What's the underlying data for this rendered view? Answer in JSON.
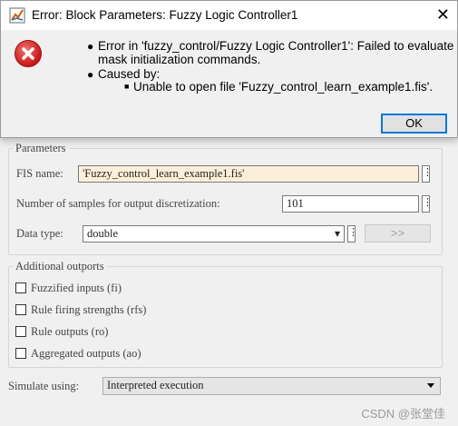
{
  "error_dialog": {
    "title": "Error: Block Parameters: Fuzzy Logic  Controller1",
    "close_glyph": "✕",
    "icon": "error-icon",
    "messages": [
      "Error in 'fuzzy_control/Fuzzy Logic Controller1': Failed to evaluate",
      "mask initialization commands.",
      "Caused by:",
      "Unable to open file 'Fuzzy_control_learn_example1.fis'."
    ],
    "ok_label": "OK"
  },
  "parameters": {
    "legend": "Parameters",
    "fis_name_label": "FIS name:",
    "fis_name_value": "'Fuzzy_control_learn_example1.fis'",
    "samples_label": "Number of samples for output discretization:",
    "samples_value": "101",
    "data_type_label": "Data type:",
    "data_type_value": "double",
    "data_type_button": ">>"
  },
  "additional_outports": {
    "legend": "Additional outports",
    "items": [
      "Fuzzified inputs (fi)",
      "Rule firing strengths (rfs)",
      "Rule outputs (ro)",
      "Aggregated outputs (ao)"
    ]
  },
  "simulate": {
    "label": "Simulate using:",
    "value": "Interpreted execution"
  },
  "dots_glyph": "⋮",
  "dropdown_glyph": "▾",
  "watermark": "CSDN @张堂佳",
  "colors": {
    "fis_field_bg": "#fcefd9",
    "accent": "#0078d7",
    "error_red": "#c81818"
  }
}
